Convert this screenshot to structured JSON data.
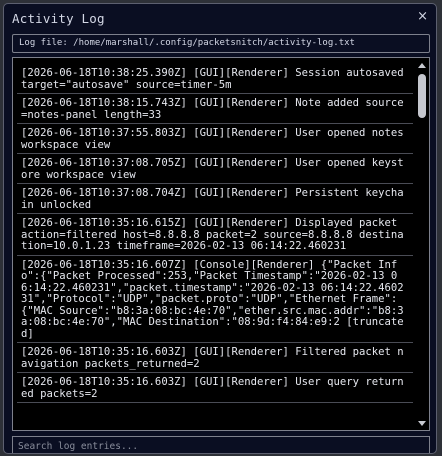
{
  "window": {
    "title": "Activity Log",
    "close_glyph": "×"
  },
  "file_path": "Log file: /home/marshall/.config/packetsnitch/activity-log.txt",
  "log_entries": [
    "[2026-06-18T10:38:25.390Z] [GUI][Renderer] Session autosaved target=\"autosave\" source=timer-5m",
    "[2026-06-18T10:38:15.743Z] [GUI][Renderer] Note added source=notes-panel length=33",
    "[2026-06-18T10:37:55.803Z] [GUI][Renderer] User opened notes workspace view",
    "[2026-06-18T10:37:08.705Z] [GUI][Renderer] User opened keystore workspace view",
    "[2026-06-18T10:37:08.704Z] [GUI][Renderer] Persistent keychain unlocked",
    "[2026-06-18T10:35:16.615Z] [GUI][Renderer] Displayed packet action=filtered host=8.8.8.8 packet=2 source=8.8.8.8 destination=10.0.1.23 timeframe=2026-02-13 06:14:22.460231",
    "[2026-06-18T10:35:16.607Z] [Console][Renderer] {\"Packet Info\":{\"Packet Processed\":253,\"Packet Timestamp\":\"2026-02-13 06:14:22.460231\",\"packet.timestamp\":\"2026-02-13 06:14:22.460231\",\"Protocol\":\"UDP\",\"packet.proto\":\"UDP\",\"Ethernet Frame\":{\"MAC Source\":\"b8:3a:08:bc:4e:70\",\"ether.src.mac.addr\":\"b8:3a:08:bc:4e:70\",\"MAC Destination\":\"08:9d:f4:84:e9:2 [truncated]",
    "[2026-06-18T10:35:16.603Z] [GUI][Renderer] Filtered packet navigation packets_returned=2",
    "[2026-06-18T10:35:16.603Z] [GUI][Renderer] User query returned packets=2"
  ],
  "search": {
    "placeholder": "Search log entries...",
    "value": ""
  },
  "icons": {
    "close": "close-icon",
    "scroll_up": "chevron-up-icon",
    "scroll_down": "chevron-down-icon"
  }
}
